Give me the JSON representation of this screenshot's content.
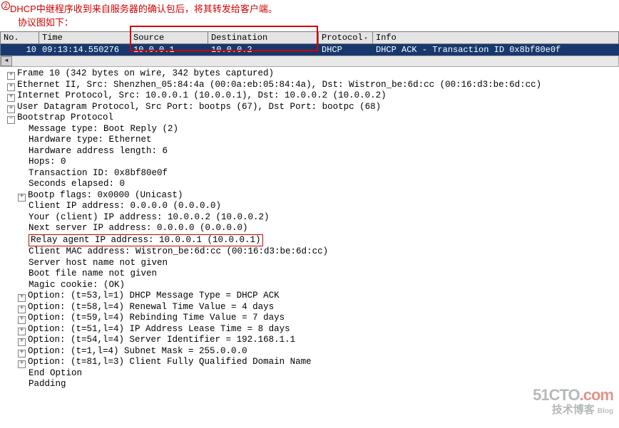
{
  "annotation": {
    "bullet": "2",
    "line1": "DHCP中继程序收到来自服务器的确认包后，将其转发给客户端。",
    "line2": "协议图如下："
  },
  "columns": {
    "no": "No.",
    "time": "Time",
    "source": "Source",
    "destination": "Destination",
    "protocol": "Protocol",
    "info": "Info"
  },
  "row": {
    "no": "10",
    "time": "09:13:14.550276",
    "source": "10.0.0.1",
    "destination": "10.0.0.2",
    "protocol": "DHCP",
    "info": "DHCP ACK      - Transaction ID 0x8bf80e0f"
  },
  "details": {
    "l0": "Frame 10 (342 bytes on wire, 342 bytes captured)",
    "l1": "Ethernet II, Src: Shenzhen_05:84:4a (00:0a:eb:05:84:4a), Dst: Wistron_be:6d:cc (00:16:d3:be:6d:cc)",
    "l2": "Internet Protocol, Src: 10.0.0.1 (10.0.0.1), Dst: 10.0.0.2 (10.0.0.2)",
    "l3": "User Datagram Protocol, Src Port: bootps (67), Dst Port: bootpc (68)",
    "l4": "Bootstrap Protocol",
    "b0": "Message type: Boot Reply (2)",
    "b1": "Hardware type: Ethernet",
    "b2": "Hardware address length: 6",
    "b3": "Hops: 0",
    "b4": "Transaction ID: 0x8bf80e0f",
    "b5": "Seconds elapsed: 0",
    "b6": "Bootp flags: 0x0000 (Unicast)",
    "b7": "Client IP address: 0.0.0.0 (0.0.0.0)",
    "b8": "Your (client) IP address: 10.0.0.2 (10.0.0.2)",
    "b9": "Next server IP address: 0.0.0.0 (0.0.0.0)",
    "b10": "Relay agent IP address: 10.0.0.1 (10.0.0.1)",
    "b11": "Client MAC address: Wistron_be:6d:cc (00:16:d3:be:6d:cc)",
    "b12": "Server host name not given",
    "b13": "Boot file name not given",
    "b14": "Magic cookie: (OK)",
    "b15": "Option: (t=53,l=1) DHCP Message Type = DHCP ACK",
    "b16": "Option: (t=58,l=4) Renewal Time Value = 4 days",
    "b17": "Option: (t=59,l=4) Rebinding Time Value = 7 days",
    "b18": "Option: (t=51,l=4) IP Address Lease Time = 8 days",
    "b19": "Option: (t=54,l=4) Server Identifier = 192.168.1.1",
    "b20": "Option: (t=1,l=4) Subnet Mask = 255.0.0.0",
    "b21": "Option: (t=81,l=3) Client Fully Qualified Domain Name",
    "b22": "End Option",
    "b23": "Padding"
  },
  "watermark": {
    "site": "51CTO",
    "suffix": ".com",
    "sub": "技术博客",
    "blog": "Blog"
  }
}
